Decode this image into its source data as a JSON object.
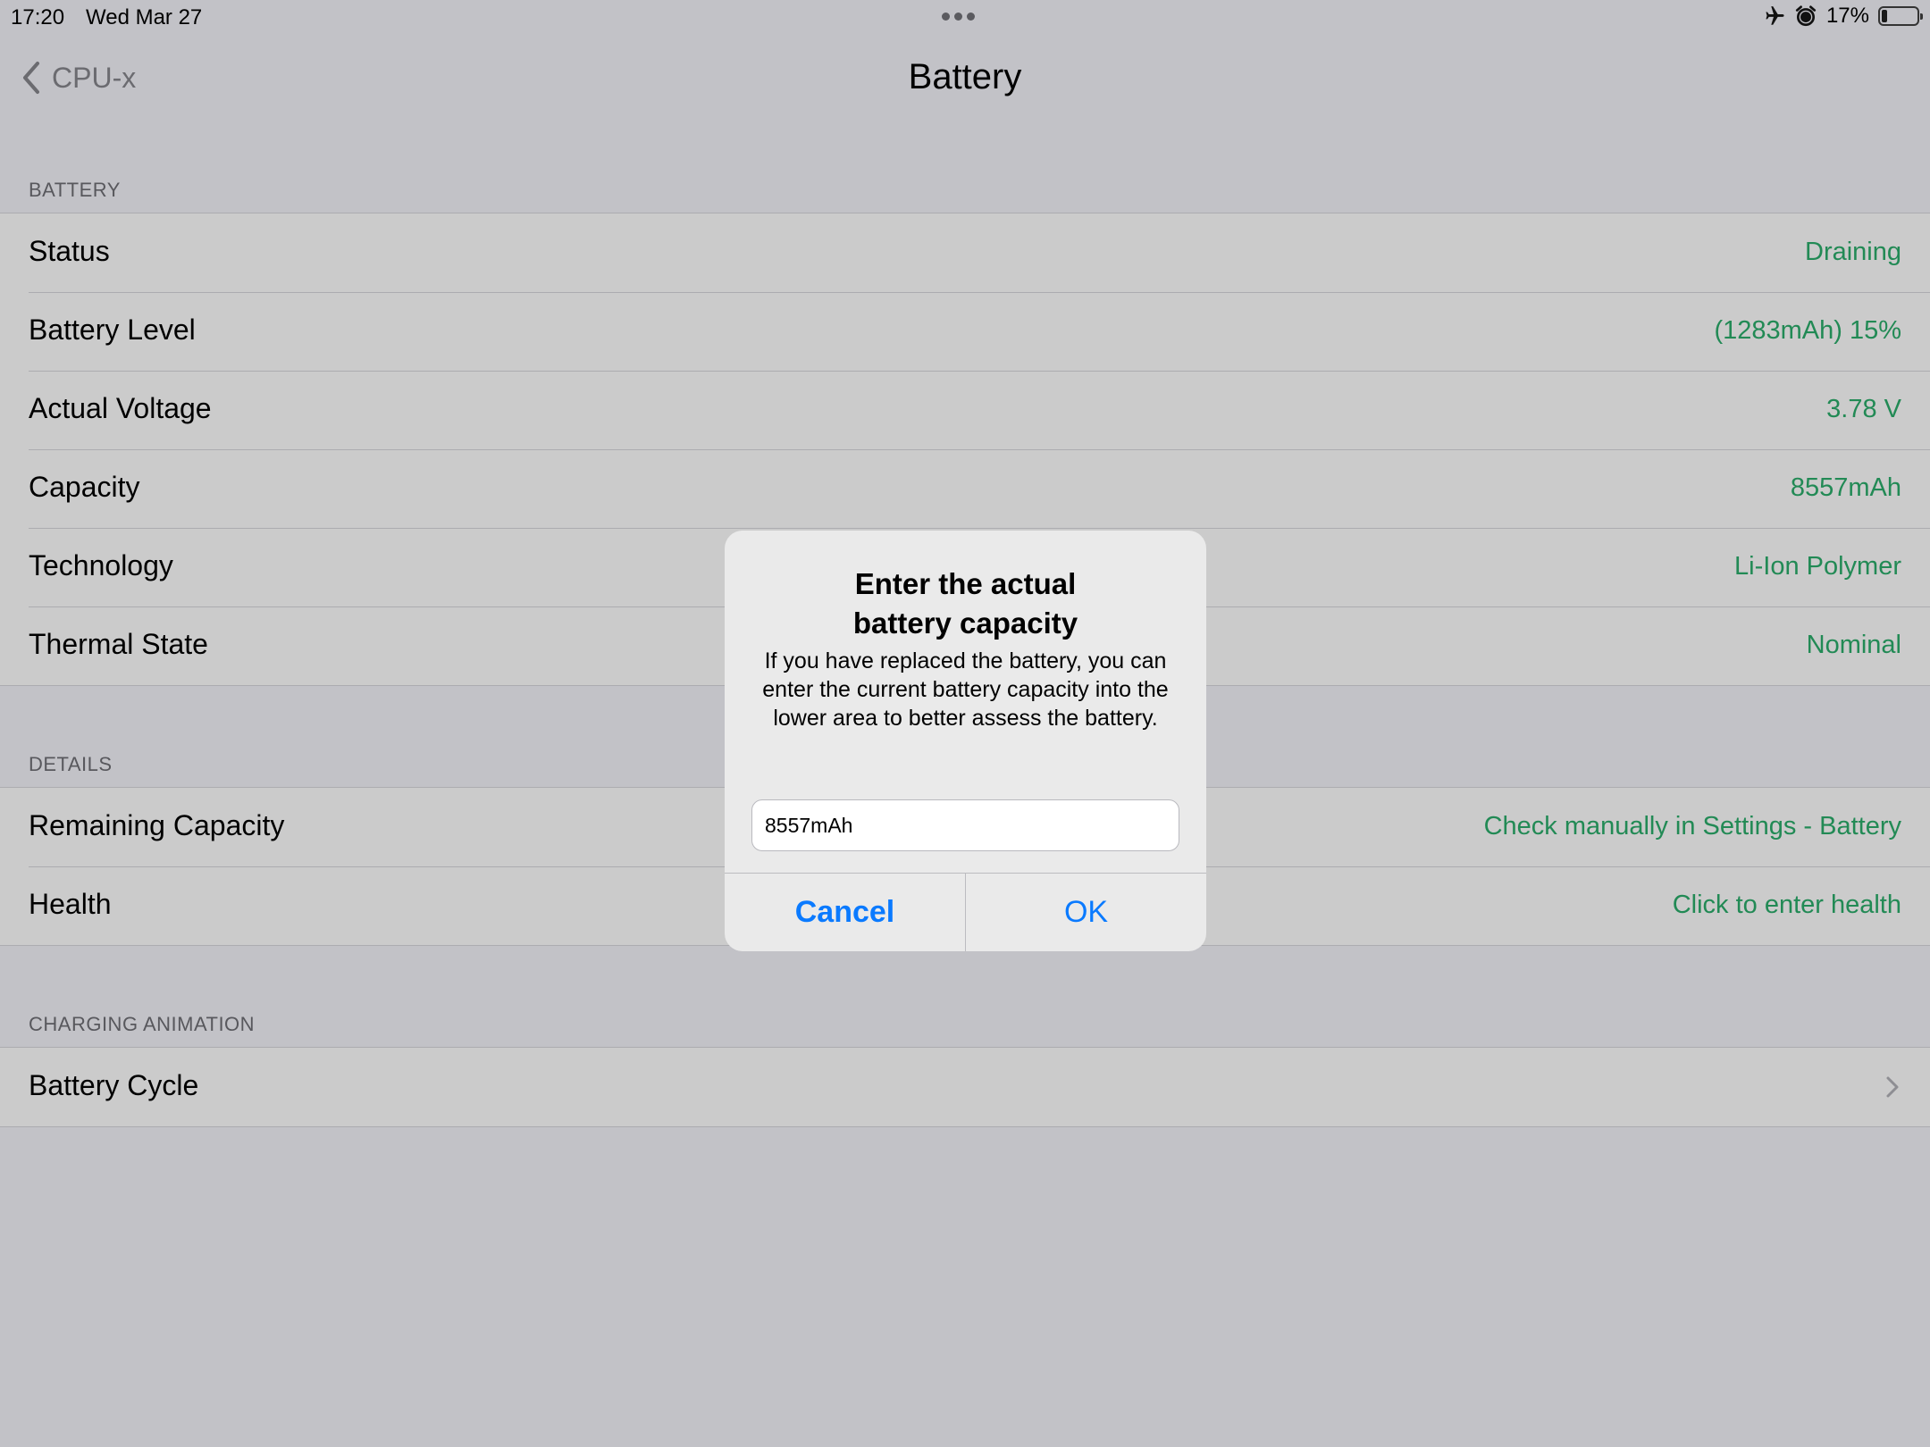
{
  "status_bar": {
    "time": "17:20",
    "date": "Wed Mar 27",
    "battery_percent": "17%",
    "battery_level": 0.17,
    "icons": [
      "airplane-icon",
      "alarm-icon",
      "battery-icon"
    ]
  },
  "nav": {
    "back_label": "CPU-x",
    "title": "Battery"
  },
  "sections": {
    "battery": {
      "header": "BATTERY",
      "rows": [
        {
          "label": "Status",
          "value": "Draining"
        },
        {
          "label": "Battery Level",
          "value": "(1283mAh) 15%"
        },
        {
          "label": "Actual Voltage",
          "value": "3.78 V"
        },
        {
          "label": "Capacity",
          "value": "8557mAh"
        },
        {
          "label": "Technology",
          "value": "Li-Ion Polymer"
        },
        {
          "label": "Thermal State",
          "value": "Nominal"
        }
      ]
    },
    "details": {
      "header": "DETAILS",
      "rows": [
        {
          "label": "Remaining Capacity",
          "value": "Check manually in Settings - Battery"
        },
        {
          "label": "Health",
          "value": "Click to enter health"
        }
      ]
    },
    "charging_animation": {
      "header": "CHARGING ANIMATION",
      "rows": [
        {
          "label": "Battery Cycle"
        }
      ]
    }
  },
  "alert": {
    "title": "Enter the actual\nbattery capacity",
    "message": "If you have replaced the battery, you can enter the current battery capacity into the lower area to better assess the battery.",
    "input_value": "8557mAh",
    "cancel_label": "Cancel",
    "ok_label": "OK"
  },
  "colors": {
    "background": "#c2c2c7",
    "cell_background": "#cbcbcb",
    "value_green": "#228a55",
    "button_blue": "#0a7aff"
  }
}
